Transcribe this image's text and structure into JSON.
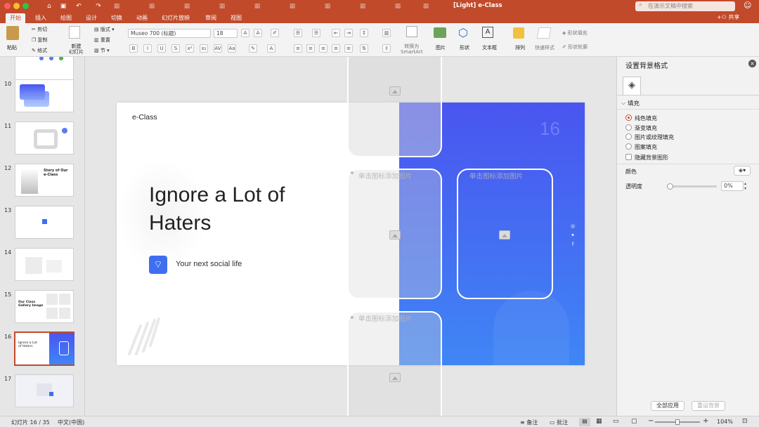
{
  "window": {
    "title": "[Light] e-Class"
  },
  "search": {
    "placeholder": "在演示文稿中搜索"
  },
  "share_label": "共享",
  "tabs": [
    {
      "label": "开始",
      "active": true
    },
    {
      "label": "插入"
    },
    {
      "label": "绘图"
    },
    {
      "label": "设计"
    },
    {
      "label": "切换"
    },
    {
      "label": "动画"
    },
    {
      "label": "幻灯片放映"
    },
    {
      "label": "审阅"
    },
    {
      "label": "视图"
    }
  ],
  "ribbon": {
    "paste": "粘贴",
    "cut": "剪切",
    "copy": "复制",
    "format": "格式",
    "new_slide": "新建\n幻灯片",
    "layout": "版式",
    "reset": "重置",
    "section": "节",
    "font_name": "Museo 700 (标题)",
    "font_size": "18",
    "convert_smartart": "转换为\nSmartArt",
    "picture": "图片",
    "shape": "形状",
    "textbox": "文本框",
    "arrange": "排列",
    "quick_styles": "快速样式",
    "shape_fill": "形状填充",
    "shape_outline": "形状轮廓"
  },
  "thumbnails": [
    {
      "num": "10"
    },
    {
      "num": "11"
    },
    {
      "num": "12",
      "text": "Story of Our e-Class"
    },
    {
      "num": "13"
    },
    {
      "num": "14"
    },
    {
      "num": "15",
      "text": "Our Class Gallery Image"
    },
    {
      "num": "16",
      "text": "Ignore a Lot of Haters",
      "selected": true
    },
    {
      "num": "17"
    }
  ],
  "slide": {
    "brand": "e-Class",
    "title_line1": "Ignore a Lot of",
    "title_line2": "Haters",
    "subtitle": "Your next social life",
    "page_number": "16",
    "placeholders": [
      "单击图标添加图片",
      "单击图标添加图片",
      "单击图标添加图片"
    ]
  },
  "panel": {
    "title": "设置背景格式",
    "section": "填充",
    "options": [
      "纯色填充",
      "渐变填充",
      "图片或纹理填充",
      "图案填充"
    ],
    "selected_option": "纯色填充",
    "hide_bg": "隐藏背景图形",
    "color_label": "颜色",
    "transparency_label": "透明度",
    "transparency_value": "0%",
    "apply_all": "全部应用",
    "reset_bg": "重设背景"
  },
  "status": {
    "slide_count": "幻灯片 16 / 35",
    "language": "中文(中国)",
    "notes": "备注",
    "comments": "批注",
    "zoom": "104%"
  },
  "colors": {
    "accent": "#c14a2b",
    "gradient_top": "#4a55f0",
    "gradient_bottom": "#3f86f5"
  }
}
